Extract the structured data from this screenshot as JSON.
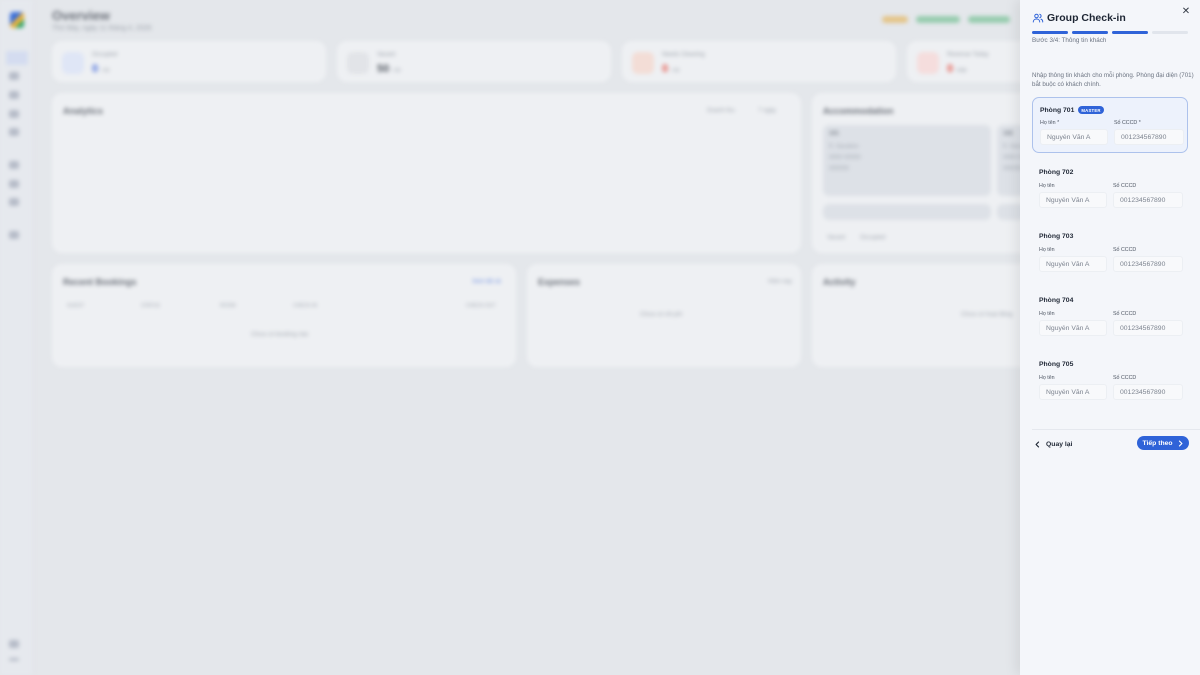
{
  "background": {
    "title": "Overview",
    "subtitle": "Thứ Bảy, ngày 11 tháng 4, 2026",
    "pills": [
      {
        "label": "online",
        "color": "#e5a93a"
      },
      {
        "label": "PHP 8.x",
        "color": "#57b77c"
      },
      {
        "label": "Connected",
        "color": "#57b77c"
      }
    ],
    "stats": [
      {
        "label": "Occupied",
        "value": "0",
        "unit": "/ 50",
        "color": "#4a6fdc"
      },
      {
        "label": "Vacant",
        "value": "50",
        "unit": "/ 50",
        "color": "#555b64"
      },
      {
        "label": "Needs Cleaning",
        "value": "0",
        "unit": "/ 50",
        "color": "#e5564a"
      },
      {
        "label": "Revenue Today",
        "value": "0",
        "unit": "VNĐ",
        "color": "#e5564a"
      }
    ],
    "analytics_title": "Analytics",
    "analytics_controls": [
      "Doanh thu",
      "7 ngày"
    ],
    "accommodation_title": "Accommodation",
    "accommodation_rooms": [
      {
        "name": "101",
        "line1": "Ít. Vacation",
        "line2": "0000 00000",
        "line3": "000000"
      },
      {
        "name": "102",
        "line1": "Ít. Vacation",
        "line2": "0000 00000",
        "line3": "000000"
      }
    ],
    "accommodation_legend": [
      "Vacant",
      "Occupied"
    ],
    "recent_title": "Recent Bookings",
    "recent_link": "Xem tất cả",
    "recent_columns": [
      "GUEST",
      "STATUS",
      "ROOM",
      "CHECK-IN",
      "CHECK-OUT"
    ],
    "recent_empty": "Chưa có booking nào",
    "expenses_title": "Expenses",
    "expenses_meta": "Hôm nay",
    "expenses_empty": "Chưa có chi phí",
    "activity_title": "Activity",
    "activity_empty": "Chưa có hoạt động"
  },
  "drawer": {
    "title": "Group Check-in",
    "title_icon": "users-icon",
    "close_icon": "close-icon",
    "progress": {
      "current": 3,
      "total": 4
    },
    "step_text": "Bước 3/4: Thông tin khách",
    "intro": "Nhập thông tin khách cho mỗi phòng. Phòng đại diện (701) bắt buộc có khách chính.",
    "rooms": [
      {
        "name": "Phòng 701",
        "badge": "MASTER",
        "name_label": "Họ tên *",
        "id_label": "Số CCCD *",
        "name_placeholder": "Nguyễn Văn A",
        "id_placeholder": "001234567890"
      },
      {
        "name": "Phòng 702",
        "badge": "",
        "name_label": "Họ tên",
        "id_label": "Số CCCD",
        "name_placeholder": "Nguyễn Văn A",
        "id_placeholder": "001234567890"
      },
      {
        "name": "Phòng 703",
        "badge": "",
        "name_label": "Họ tên",
        "id_label": "Số CCCD",
        "name_placeholder": "Nguyễn Văn A",
        "id_placeholder": "001234567890"
      },
      {
        "name": "Phòng 704",
        "badge": "",
        "name_label": "Họ tên",
        "id_label": "Số CCCD",
        "name_placeholder": "Nguyễn Văn A",
        "id_placeholder": "001234567890"
      },
      {
        "name": "Phòng 705",
        "badge": "",
        "name_label": "Họ tên",
        "id_label": "Số CCCD",
        "name_placeholder": "Nguyễn Văn A",
        "id_placeholder": "001234567890"
      }
    ],
    "back_label": "Quay lại",
    "back_icon": "chevron-left-icon",
    "next_label": "Tiếp theo",
    "next_icon": "chevron-right-icon",
    "accent_color": "#2f63d8"
  }
}
